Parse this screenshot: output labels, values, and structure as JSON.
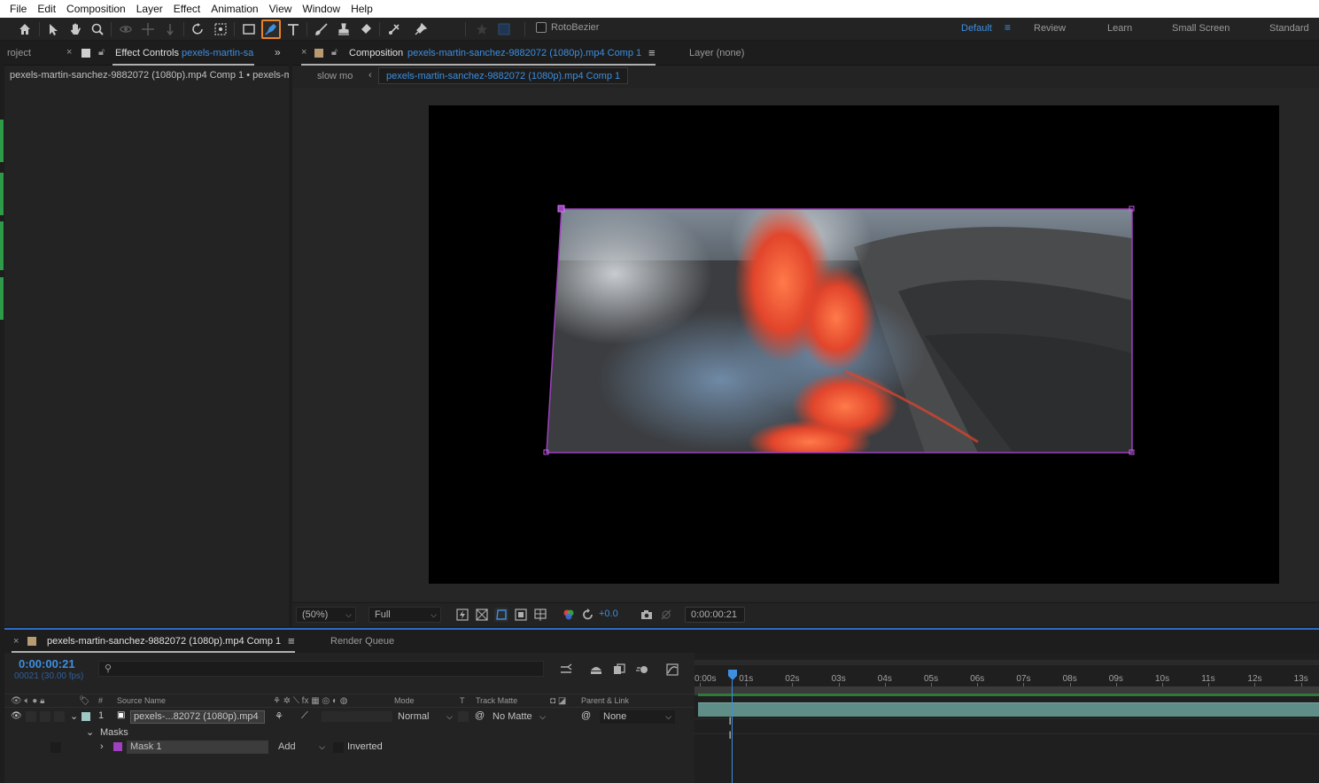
{
  "menu": [
    "File",
    "Edit",
    "Composition",
    "Layer",
    "Effect",
    "Animation",
    "View",
    "Window",
    "Help"
  ],
  "toolbar": {
    "rotobezier_label": "RotoBezier",
    "workspaces": [
      {
        "label": "Default",
        "active": true
      },
      {
        "label": "Review",
        "active": false
      },
      {
        "label": "Learn",
        "active": false
      },
      {
        "label": "Small Screen",
        "active": false
      },
      {
        "label": "Standard",
        "active": false
      }
    ]
  },
  "left_panel": {
    "project_tab": "roject",
    "effect_controls_label": "Effect Controls",
    "effect_controls_target": "pexels-martin-sa",
    "path": "pexels-martin-sanchez-9882072 (1080p).mp4 Comp 1 • pexels-m"
  },
  "comp_panel": {
    "comp_label": "Composition",
    "comp_name": "pexels-martin-sanchez-9882072 (1080p).mp4 Comp 1",
    "layer_label": "Layer (none)",
    "breadcrumb_prev": "slow mo",
    "breadcrumb_current": "pexels-martin-sanchez-9882072 (1080p).mp4 Comp 1"
  },
  "viewer_bar": {
    "zoom": "(50%)",
    "resolution": "Full",
    "exposure": "+0.0",
    "timecode": "0:00:00:21"
  },
  "timeline": {
    "comp_tab": "pexels-martin-sanchez-9882072 (1080p).mp4 Comp 1",
    "render_queue": "Render Queue",
    "current_time": "0:00:00:21",
    "frame_info": "00021 (30.00 fps)",
    "columns": {
      "num": "#",
      "source_name": "Source Name",
      "mode": "Mode",
      "t": "T",
      "track_matte": "Track Matte",
      "parent": "Parent & Link"
    },
    "layer": {
      "number": "1",
      "name": "pexels-...82072 (1080p).mp4",
      "mode": "Normal",
      "track_matte": "No Matte",
      "parent": "None"
    },
    "masks_label": "Masks",
    "mask": {
      "name": "Mask 1",
      "mode": "Add",
      "inverted_label": "Inverted"
    },
    "ruler": [
      "0:00s",
      "01s",
      "02s",
      "03s",
      "04s",
      "05s",
      "06s",
      "07s",
      "08s",
      "09s",
      "10s",
      "11s",
      "12s",
      "13s"
    ],
    "playhead_seconds": 0.7
  }
}
